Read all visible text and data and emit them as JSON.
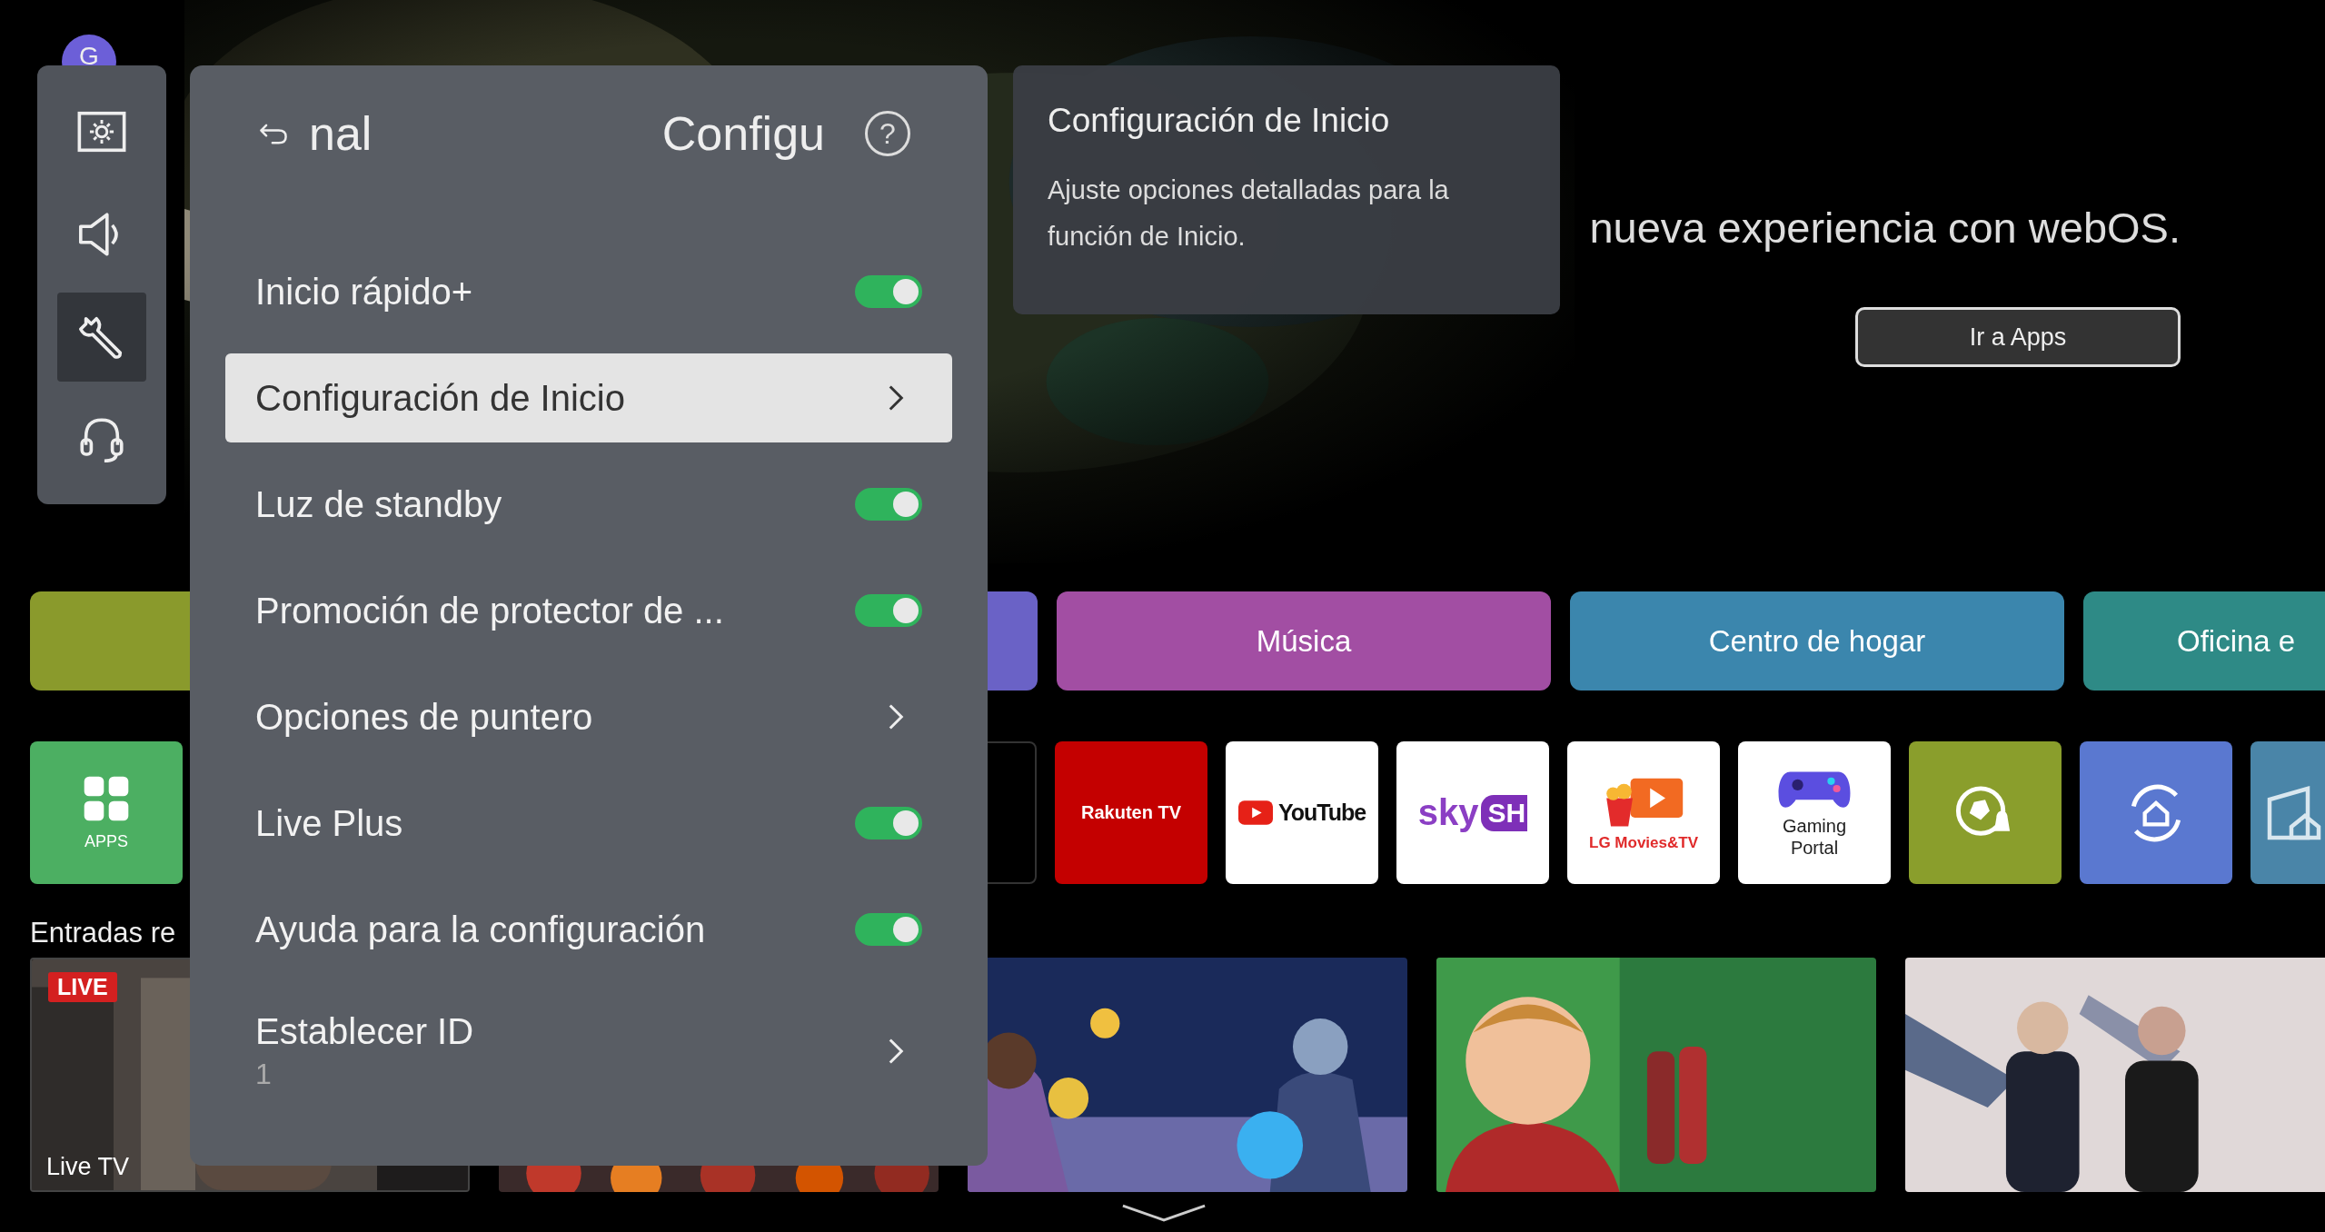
{
  "profile": {
    "initial": "G"
  },
  "sidebar": {
    "items": [
      {
        "kind": "picture",
        "selected": false
      },
      {
        "kind": "sound",
        "selected": false
      },
      {
        "kind": "general",
        "selected": true
      },
      {
        "kind": "support",
        "selected": false
      }
    ]
  },
  "settings_menu": {
    "breadcrumb": "nal",
    "title": "Configu",
    "help": "?",
    "items": [
      {
        "kind": "toggle",
        "label": "Inicio rápido+",
        "on": true,
        "selected": false
      },
      {
        "kind": "link",
        "label": "Configuración de Inicio",
        "selected": true
      },
      {
        "kind": "toggle",
        "label": "Luz de standby",
        "on": true,
        "selected": false
      },
      {
        "kind": "toggle",
        "label": "Promoción de protector de ...",
        "on": true,
        "selected": false
      },
      {
        "kind": "link",
        "label": "Opciones de puntero",
        "selected": false
      },
      {
        "kind": "toggle",
        "label": "Live Plus",
        "on": true,
        "selected": false
      },
      {
        "kind": "toggle",
        "label": "Ayuda para la configuración",
        "on": true,
        "selected": false
      },
      {
        "kind": "link",
        "label": "Establecer ID",
        "value": "1",
        "selected": false
      }
    ]
  },
  "tooltip": {
    "title": "Configuración de Inicio",
    "text": "Ajuste opciones detalladas para la función de Inicio."
  },
  "hero": {
    "headline": "nueva experiencia con webOS.",
    "button": "Ir a Apps"
  },
  "categories": [
    {
      "color": "#8a9a2c"
    },
    {
      "color": "#6a62c6"
    },
    {
      "label": "Música",
      "color": "#a24ea3"
    },
    {
      "label": "Centro de hogar",
      "color": "#3b86ad"
    },
    {
      "label": "Oficina e",
      "color": "#2e8a86"
    }
  ],
  "apps": [
    {
      "kind": "apps",
      "label": "APPS"
    },
    {
      "kind": "dark"
    },
    {
      "kind": "rakuten",
      "label": "Rakuten TV"
    },
    {
      "kind": "youtube",
      "label": "YouTube"
    },
    {
      "kind": "sky",
      "label": "sky",
      "label_2": "SH"
    },
    {
      "kind": "lgmovies",
      "label": "LG Movies&TV"
    },
    {
      "kind": "gaming",
      "label": "Gaming Portal"
    },
    {
      "kind": "soccer"
    },
    {
      "kind": "home"
    },
    {
      "kind": "partial"
    }
  ],
  "recent": {
    "heading": "Entradas re",
    "cards": [
      {
        "kind": "live",
        "badge": "LIVE",
        "label": "Live TV"
      },
      {
        "kind": "picture"
      },
      {
        "kind": "picture"
      },
      {
        "kind": "picture"
      },
      {
        "kind": "picture"
      }
    ]
  }
}
